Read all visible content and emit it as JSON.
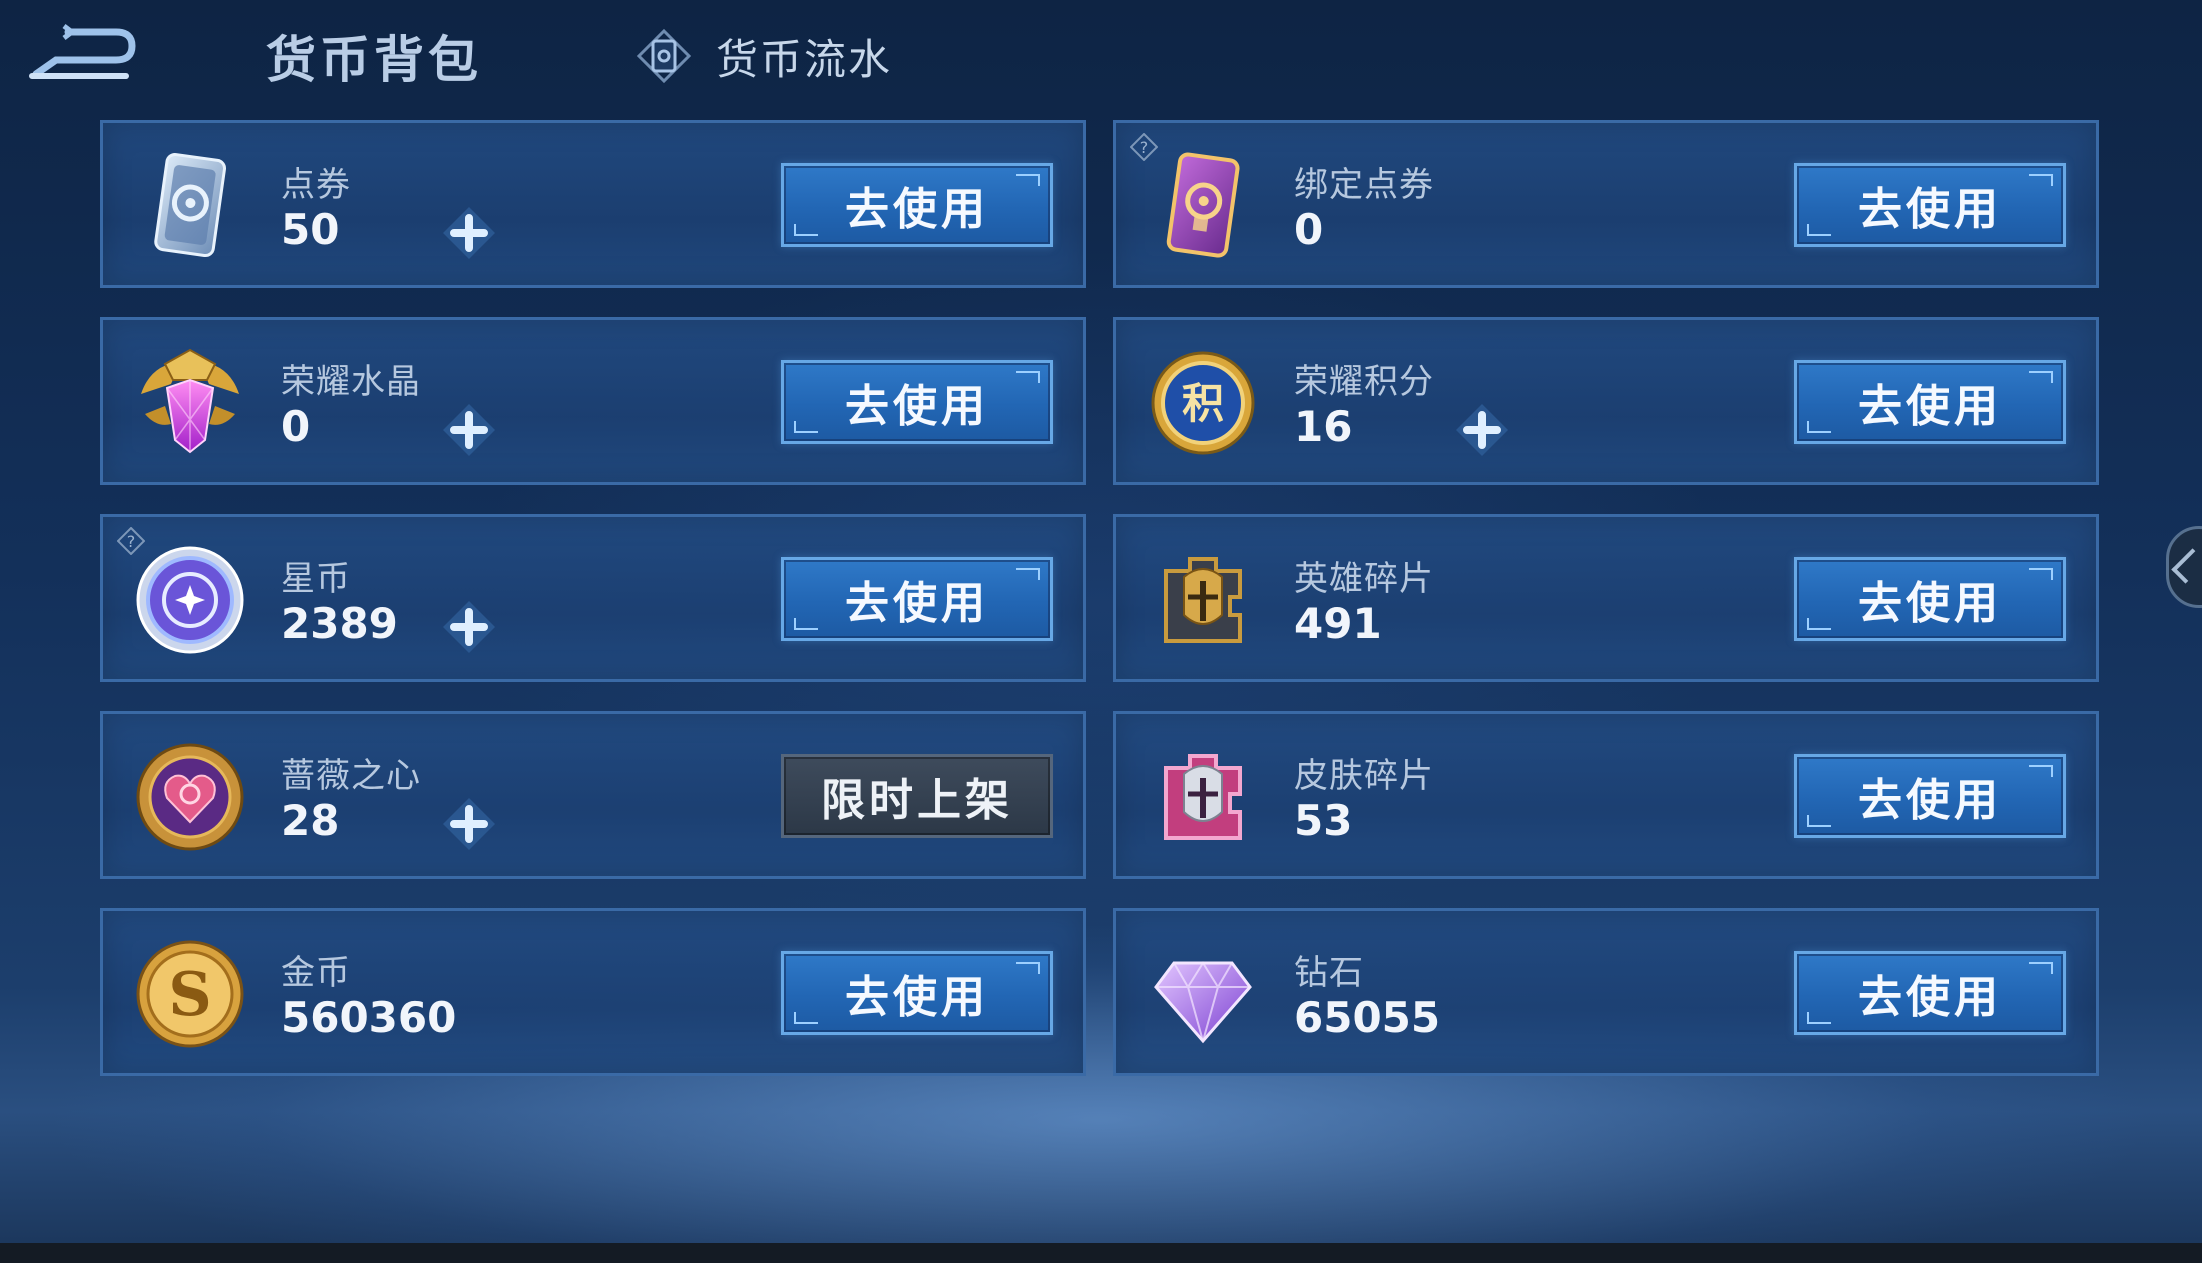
{
  "header": {
    "title": "货币背包",
    "flow_tab_label": "货币流水"
  },
  "use_label": "去使用",
  "limited_label": "限时上架",
  "cards": [
    {
      "name": "点券",
      "amount": "50",
      "icon": "coupon-icon",
      "has_plus": true,
      "has_help": false,
      "button": "use"
    },
    {
      "name": "绑定点券",
      "amount": "0",
      "icon": "bound-coupon-icon",
      "has_plus": false,
      "has_help": true,
      "button": "use"
    },
    {
      "name": "荣耀水晶",
      "amount": "0",
      "icon": "glory-crystal-icon",
      "has_plus": true,
      "has_help": false,
      "button": "use"
    },
    {
      "name": "荣耀积分",
      "amount": "16",
      "icon": "glory-points-icon",
      "has_plus": true,
      "has_help": false,
      "button": "use"
    },
    {
      "name": "星币",
      "amount": "2389",
      "icon": "star-coin-icon",
      "has_plus": true,
      "has_help": true,
      "button": "use"
    },
    {
      "name": "英雄碎片",
      "amount": "491",
      "icon": "hero-fragment-icon",
      "has_plus": false,
      "has_help": false,
      "button": "use"
    },
    {
      "name": "蔷薇之心",
      "amount": "28",
      "icon": "rose-heart-icon",
      "has_plus": true,
      "has_help": false,
      "button": "limited"
    },
    {
      "name": "皮肤碎片",
      "amount": "53",
      "icon": "skin-fragment-icon",
      "has_plus": false,
      "has_help": false,
      "button": "use"
    },
    {
      "name": "金币",
      "amount": "560360",
      "icon": "gold-coin-icon",
      "has_plus": false,
      "has_help": false,
      "button": "use"
    },
    {
      "name": "钻石",
      "amount": "65055",
      "icon": "diamond-icon",
      "has_plus": false,
      "has_help": false,
      "button": "use"
    }
  ]
}
